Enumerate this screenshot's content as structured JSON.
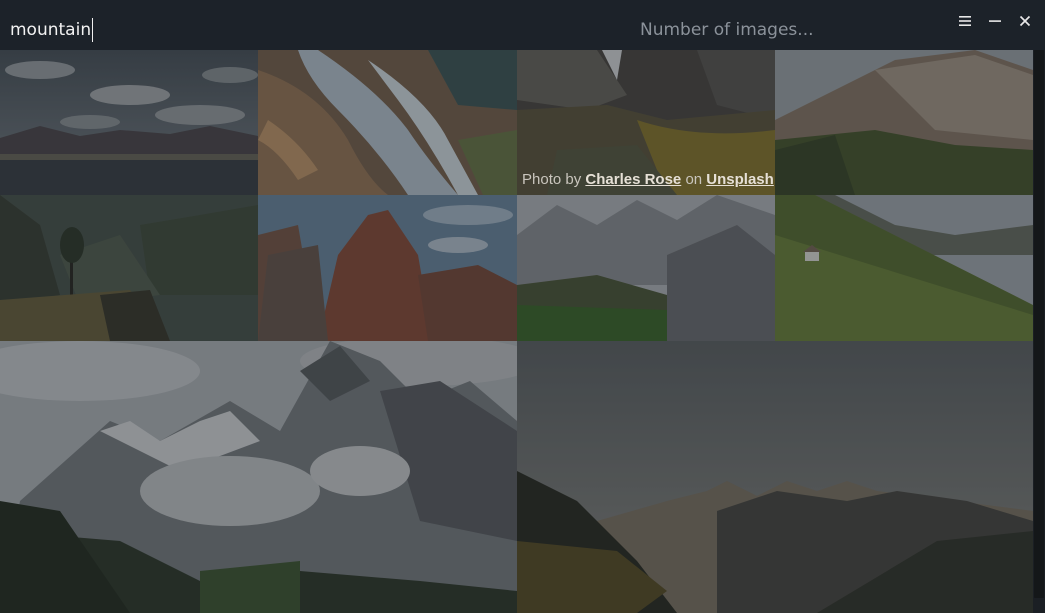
{
  "search": {
    "value": "mountain",
    "count_placeholder": "Number of images..."
  },
  "window_controls": {
    "menu_glyph": "☰",
    "minimize_glyph": "—",
    "close_glyph": "✕"
  },
  "credit": {
    "prefix": "Photo by",
    "author": "Charles Rose",
    "middle": "on",
    "site": "Unsplash"
  },
  "colors": {
    "topbar": "#1c2229",
    "background": "#1b1f24",
    "placeholder": "#8b929a"
  },
  "icons": [
    "hamburger-menu-icon",
    "minimize-icon",
    "close-icon"
  ]
}
